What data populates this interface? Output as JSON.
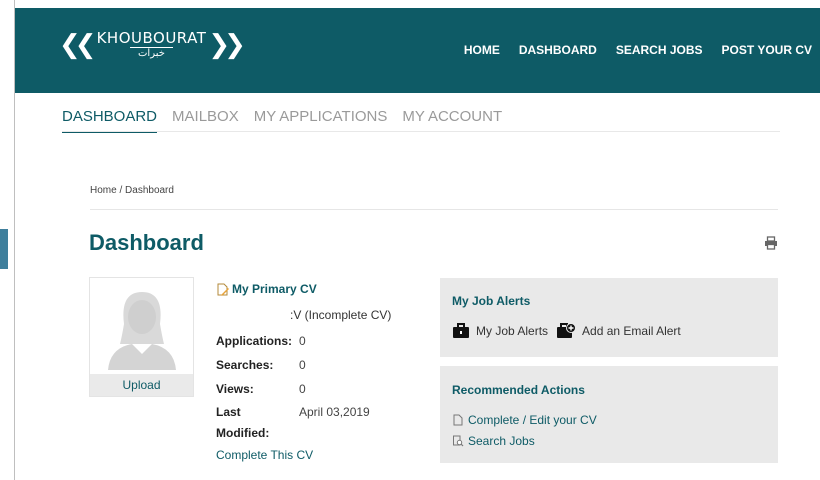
{
  "header": {
    "logo_text": "KHOUBOURAT",
    "logo_arabic": "خبرات",
    "nav": [
      "HOME",
      "DASHBOARD",
      "SEARCH JOBS",
      "POST YOUR CV"
    ]
  },
  "tabs": {
    "items": [
      "DASHBOARD",
      "MAILBOX",
      "MY APPLICATIONS",
      "MY ACCOUNT"
    ],
    "active": "DASHBOARD"
  },
  "breadcrumb": {
    "home": "Home",
    "sep": " / ",
    "current": "Dashboard"
  },
  "page_title": "Dashboard",
  "avatar": {
    "upload_label": "Upload"
  },
  "cv": {
    "title": "My Primary CV",
    "name": ":V (Incomplete CV)",
    "stats": [
      {
        "label": "Applications:",
        "value": "0"
      },
      {
        "label": "Searches:",
        "value": "0"
      },
      {
        "label": "Views:",
        "value": "0"
      },
      {
        "label": "Last",
        "value": "April 03,2019"
      },
      {
        "label": "Modified:",
        "value": ""
      }
    ],
    "complete_link": "Complete This CV"
  },
  "job_alerts": {
    "title": "My Job Alerts",
    "my_alerts": "My Job Alerts",
    "add_alert": "Add an Email Alert"
  },
  "recommended": {
    "title": "Recommended Actions",
    "actions": [
      "Complete / Edit your CV",
      "Search Jobs"
    ]
  },
  "colors": {
    "brand": "#0e5b66",
    "panel": "#e9e9e9"
  }
}
